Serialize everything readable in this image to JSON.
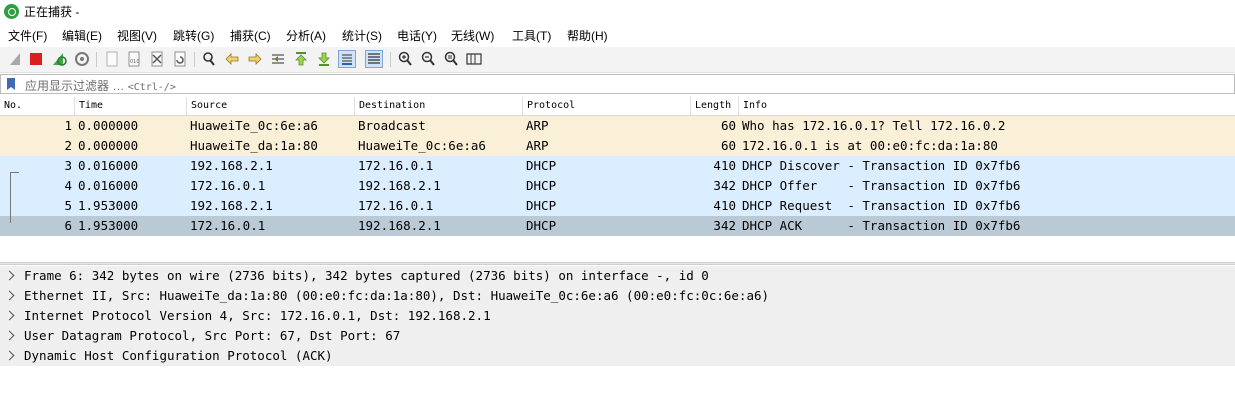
{
  "window": {
    "title": "正在捕获 -"
  },
  "menu": [
    "文件(F)",
    "编辑(E)",
    "视图(V)",
    "跳转(G)",
    "捕获(C)",
    "分析(A)",
    "统计(S)",
    "电话(Y)",
    "无线(W)",
    "工具(T)",
    "帮助(H)"
  ],
  "toolbar": {
    "buttons": [
      "start-capture-icon",
      "stop-capture-icon",
      "restart-capture-icon",
      "capture-options-icon",
      "open-file-icon",
      "save-file-icon",
      "close-file-icon",
      "reload-file-icon",
      "find-packet-icon",
      "go-back-icon",
      "go-forward-icon",
      "go-to-packet-icon",
      "go-first-icon",
      "go-last-icon",
      "autoscroll-icon",
      "colorize-icon",
      "zoom-in-icon",
      "zoom-out-icon",
      "zoom-normal-icon",
      "resize-columns-icon"
    ]
  },
  "filter": {
    "placeholder": "应用显示过滤器 …",
    "shortcut": "<Ctrl-/>"
  },
  "columns": [
    "No.",
    "Time",
    "Source",
    "Destination",
    "Protocol",
    "Length",
    "Info"
  ],
  "packets": [
    {
      "no": "1",
      "time": "0.000000",
      "source": "HuaweiTe_0c:6e:a6",
      "destination": "Broadcast",
      "protocol": "ARP",
      "length": "60",
      "info": "Who has 172.16.0.1? Tell 172.16.0.2",
      "color": "#faf0d7"
    },
    {
      "no": "2",
      "time": "0.000000",
      "source": "HuaweiTe_da:1a:80",
      "destination": "HuaweiTe_0c:6e:a6",
      "protocol": "ARP",
      "length": "60",
      "info": "172.16.0.1 is at 00:e0:fc:da:1a:80",
      "color": "#faf0d7"
    },
    {
      "no": "3",
      "time": "0.016000",
      "source": "192.168.2.1",
      "destination": "172.16.0.1",
      "protocol": "DHCP",
      "length": "410",
      "info": "DHCP Discover - Transaction ID 0x7fb6",
      "color": "#daeeff"
    },
    {
      "no": "4",
      "time": "0.016000",
      "source": "172.16.0.1",
      "destination": "192.168.2.1",
      "protocol": "DHCP",
      "length": "342",
      "info": "DHCP Offer    - Transaction ID 0x7fb6",
      "color": "#daeeff"
    },
    {
      "no": "5",
      "time": "1.953000",
      "source": "192.168.2.1",
      "destination": "172.16.0.1",
      "protocol": "DHCP",
      "length": "410",
      "info": "DHCP Request  - Transaction ID 0x7fb6",
      "color": "#daeeff"
    },
    {
      "no": "6",
      "time": "1.953000",
      "source": "172.16.0.1",
      "destination": "192.168.2.1",
      "protocol": "DHCP",
      "length": "342",
      "info": "DHCP ACK      - Transaction ID 0x7fb6",
      "color": "#b9cad6",
      "selected": true
    }
  ],
  "details": [
    "Frame 6: 342 bytes on wire (2736 bits), 342 bytes captured (2736 bits) on interface -, id 0",
    "Ethernet II, Src: HuaweiTe_da:1a:80 (00:e0:fc:da:1a:80), Dst: HuaweiTe_0c:6e:a6 (00:e0:fc:0c:6e:a6)",
    "Internet Protocol Version 4, Src: 172.16.0.1, Dst: 192.168.2.1",
    "User Datagram Protocol, Src Port: 67, Dst Port: 67",
    "Dynamic Host Configuration Protocol (ACK)"
  ]
}
